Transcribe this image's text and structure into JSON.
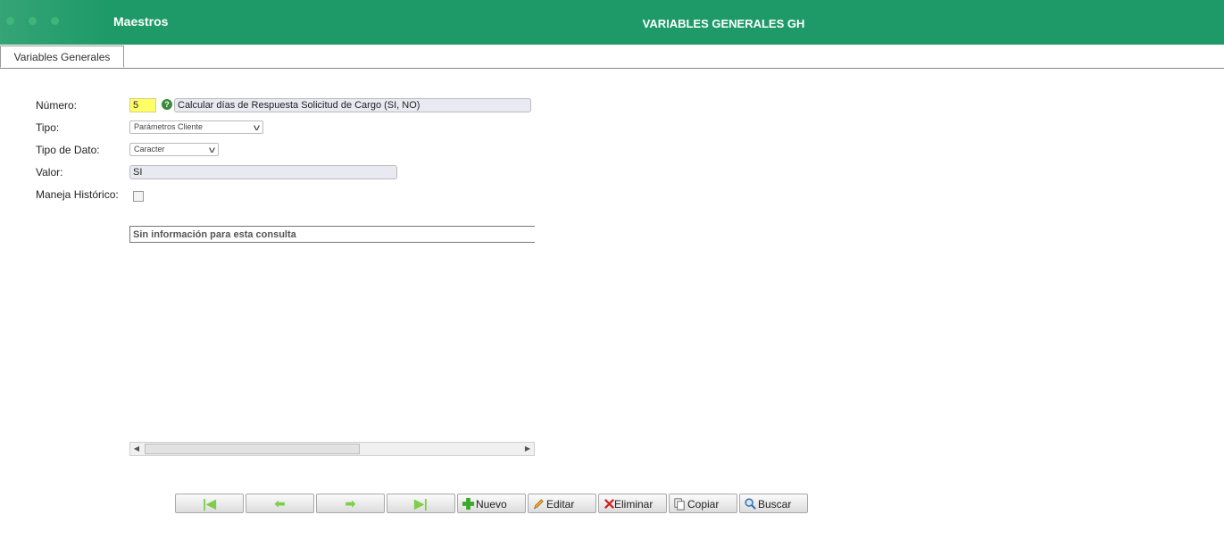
{
  "header": {
    "app_title": "Maestros",
    "window_title": "VARIABLES GENERALES GH"
  },
  "tabs": [
    {
      "label": "Variables Generales"
    }
  ],
  "form": {
    "numero": {
      "label": "Número:",
      "value": "5",
      "description": "Calcular días de Respuesta Solicitud de Cargo (SI, NO)"
    },
    "tipo": {
      "label": "Tipo:",
      "selected": "Parámetros Cliente"
    },
    "tipo_dato": {
      "label": "Tipo de Dato:",
      "selected": "Caracter"
    },
    "valor": {
      "label": "Valor:",
      "value": "SI"
    },
    "maneja_historico": {
      "label": "Maneja Histórico:",
      "checked": false
    }
  },
  "grid": {
    "empty_message": "Sin información para esta consulta"
  },
  "toolbar": {
    "nuevo_label": "Nuevo",
    "editar_label": "Editar",
    "eliminar_label": "Eliminar",
    "copiar_label": "Copiar",
    "buscar_label": "Buscar"
  },
  "colors": {
    "header_bg": "#1e9a68",
    "highlight_input": "#ffff66",
    "readonly_input": "#e9e9f2"
  },
  "icons": [
    "help-icon",
    "first-record-icon",
    "previous-record-icon",
    "next-record-icon",
    "last-record-icon",
    "plus-icon",
    "pencil-icon",
    "delete-x-icon",
    "copy-icon",
    "magnifier-icon"
  ]
}
